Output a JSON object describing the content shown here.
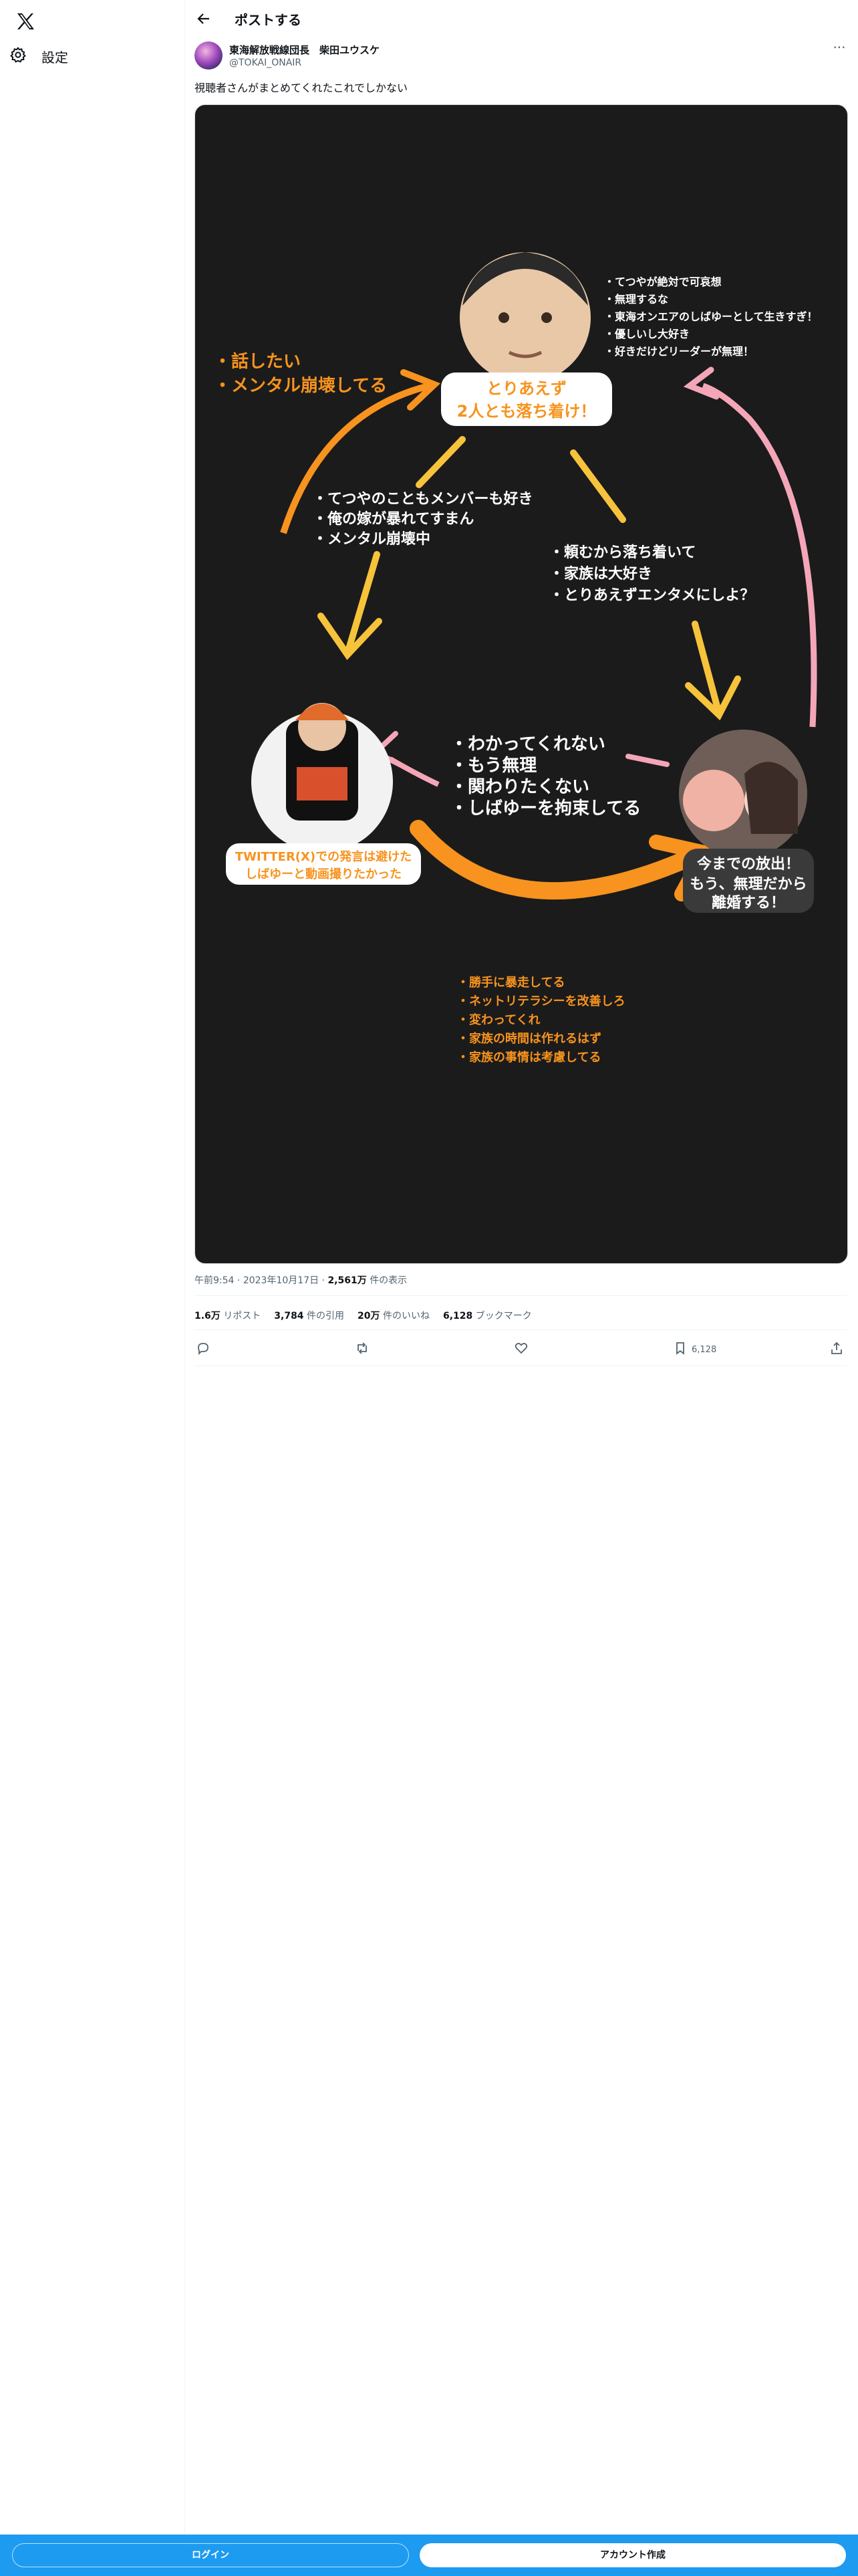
{
  "sidebar": {
    "settings_label": "設定"
  },
  "header": {
    "title": "ポストする"
  },
  "post": {
    "author_name": "東海解放戦線団長　柴田ユウスケ",
    "author_handle": "@TOKAI_ONAIR",
    "text": "視聴者さんがまとめてくれたこれでしかない",
    "time": "午前9:54",
    "date": "2023年10月17日",
    "views": "2,561万",
    "views_label": "件の表示",
    "reposts": "1.6万",
    "reposts_label": "リポスト",
    "quotes": "3,784",
    "quotes_label": "件の引用",
    "likes": "20万",
    "likes_label": "件のいいね",
    "bookmarks": "6,128",
    "bookmarks_label": "ブックマーク",
    "bookmark_action_count": "6,128"
  },
  "image": {
    "top_bullets": [
      "・てつやが絶対で可哀想",
      "・無理するな",
      "・東海オンエアのしばゆーとして生きすぎ！",
      "・優しいし大好き",
      "・好きだけどリーダーが無理！"
    ],
    "left_bullets": [
      "・話したい",
      "・メンタル崩壊してる"
    ],
    "top_label": [
      "とりあえず",
      "2人とも落ち着け！"
    ],
    "center_left_bullets": [
      "・てつやのこともメンバーも好き",
      "・俺の嫁が暴れてすまん",
      "・メンタル崩壊中"
    ],
    "center_right_bullets": [
      "・頼むから落ち着いて",
      "・家族は大好き",
      "・とりあえずエンタメにしよ？"
    ],
    "mid_bullets": [
      "・わかってくれない",
      "・もう無理",
      "・関わりたくない",
      "・しばゆーを拘束してる"
    ],
    "left_label": [
      "TWITTER(X)での発言は避けた",
      "しばゆーと動画撮りたかった"
    ],
    "right_label": [
      "今までの放出！",
      "もう、無理だから",
      "離婚する！"
    ],
    "bottom_bullets": [
      "・勝手に暴走してる",
      "・ネットリテラシーを改善しろ",
      "・変わってくれ",
      "・家族の時間は作れるはず",
      "・家族の事情は考慮してる"
    ]
  },
  "bottom_bar": {
    "login": "ログイン",
    "signup": "アカウント作成"
  },
  "colors": {
    "brand_blue": "#1d9bf0",
    "orange": "#f7931e",
    "yellow": "#f6c33b",
    "pink": "#f4a6b8"
  }
}
